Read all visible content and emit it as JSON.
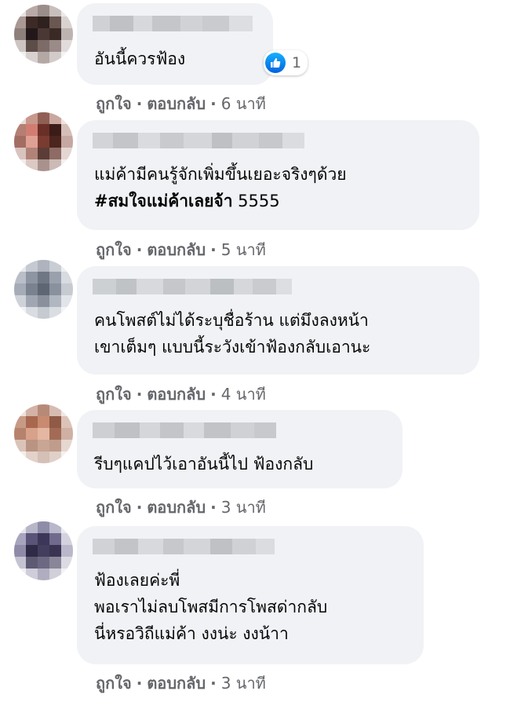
{
  "comments": [
    {
      "text_lines": [
        "อันนี้ควรฟ้อง"
      ],
      "actions": {
        "like": "ถูกใจ",
        "reply": "ตอบกลับ",
        "time": "6 นาที"
      },
      "reaction": {
        "icon": "like-icon",
        "count": "1"
      }
    },
    {
      "text_lines": [
        "แม่ค้ามีคนรู้จักเพิ่มขึ้นเยอะจริงๆด้วย"
      ],
      "hashtag": "#สมใจแม่ค้าเลยจ้า",
      "hashtag_suffix": " 5555",
      "actions": {
        "like": "ถูกใจ",
        "reply": "ตอบกลับ",
        "time": "5 นาที"
      }
    },
    {
      "text_lines": [
        "คนโพสต์ไม่ได้ระบุชื่อร้าน แต่มึงลงหน้า",
        "เขาเต็มๆ แบบนี้ระวังเข้าฟ้องกลับเอานะ"
      ],
      "actions": {
        "like": "ถูกใจ",
        "reply": "ตอบกลับ",
        "time": "4 นาที"
      }
    },
    {
      "text_lines": [
        "รีบๆแคปไว้เอาอันนี้ไป ฟ้องกลับ"
      ],
      "actions": {
        "like": "ถูกใจ",
        "reply": "ตอบกลับ",
        "time": "3 นาที"
      }
    },
    {
      "text_lines": [
        "ฟ้องเลยค่ะพี่",
        "พอเราไม่ลบโพสมีการโพสด่ากลับ",
        "นี่หรอวิถีแม่ค้า งงน่ะ งงน้าา"
      ],
      "actions": {
        "like": "ถูกใจ",
        "reply": "ตอบกลับ",
        "time": "3 นาที"
      }
    }
  ],
  "colors": {
    "bubble": "#f0f2f5",
    "meta_text": "#65676b",
    "like_blue": "#1877f2"
  }
}
